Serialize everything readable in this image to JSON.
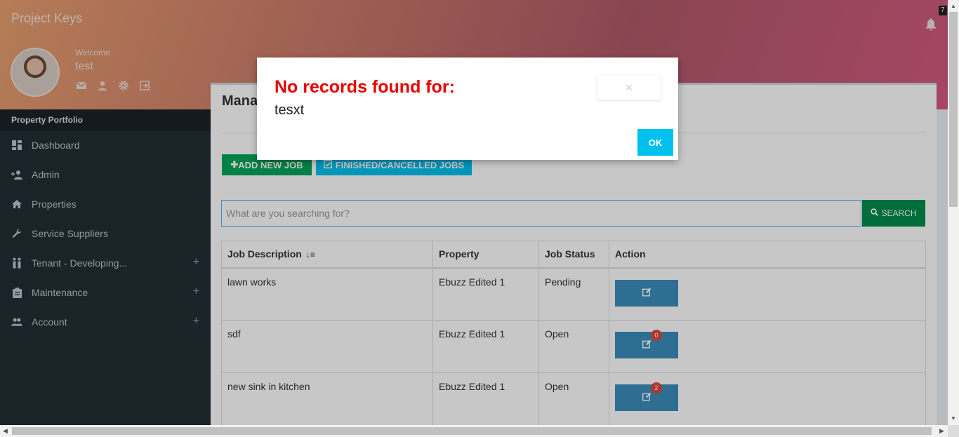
{
  "app": {
    "title": "Project Keys",
    "notification_count": "7"
  },
  "profile": {
    "welcome": "Welcome",
    "name": "test"
  },
  "sidebar": {
    "header": "Property Portfolio",
    "items": [
      {
        "label": "Dashboard",
        "icon": "dashboard-icon"
      },
      {
        "label": "Admin",
        "icon": "add-person-icon"
      },
      {
        "label": "Properties",
        "icon": "home-icon"
      },
      {
        "label": "Service Suppliers",
        "icon": "wrench-icon"
      },
      {
        "label": "Tenant - Developing...",
        "icon": "people-icon",
        "expandable": true
      },
      {
        "label": "Maintenance",
        "icon": "clipboard-icon",
        "expandable": true
      },
      {
        "label": "Account",
        "icon": "group-icon",
        "expandable": true
      }
    ]
  },
  "main": {
    "title": "Mana",
    "add_button": "ADD NEW JOB",
    "finished_button": "FINISHED/CANCELLED JOBS",
    "search_placeholder": "What are you searching for?",
    "search_button": "SEARCH",
    "table": {
      "columns": [
        "Job Description",
        "Property",
        "Job Status",
        "Action"
      ],
      "rows": [
        {
          "description": "lawn works",
          "property": "Ebuzz Edited 1",
          "status": "Pending",
          "badge": ""
        },
        {
          "description": "sdf",
          "property": "Ebuzz Edited 1",
          "status": "Open",
          "badge": "0"
        },
        {
          "description": "new sink in kitchen",
          "property": "Ebuzz Edited 1",
          "status": "Open",
          "badge": "2"
        }
      ]
    }
  },
  "modal": {
    "title": "No records found for:",
    "message": "tesxt",
    "close": "×",
    "ok": "OK"
  },
  "colors": {
    "sidebar_bg": "#222d32",
    "success": "#00a65a",
    "info": "#00c0ef",
    "primary": "#3c8dbc",
    "modal_title": "#ea0000"
  }
}
